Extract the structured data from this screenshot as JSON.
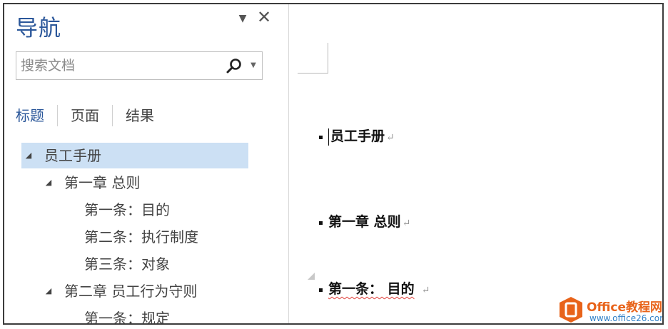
{
  "nav": {
    "title": "导航",
    "menu_glyph": "▼",
    "close_glyph": "✕",
    "search": {
      "placeholder": "搜索文档",
      "value": "",
      "dropdown_glyph": "▼"
    },
    "tabs": [
      {
        "label": "标题",
        "active": true
      },
      {
        "label": "页面",
        "active": false
      },
      {
        "label": "结果",
        "active": false
      }
    ],
    "tree": [
      {
        "label": "员工手册",
        "level": 1,
        "expanded": true,
        "selected": true,
        "arrow": "◢"
      },
      {
        "label": "第一章 总则",
        "level": 2,
        "expanded": true,
        "selected": false,
        "arrow": "◢"
      },
      {
        "label": "第一条：目的",
        "level": 3,
        "selected": false
      },
      {
        "label": "第二条：执行制度",
        "level": 3,
        "selected": false
      },
      {
        "label": "第三条：对象",
        "level": 3,
        "selected": false
      },
      {
        "label": "第二章 员工行为守则",
        "level": 2,
        "expanded": true,
        "selected": false,
        "arrow": "◢"
      },
      {
        "label": "第一条：规定",
        "level": 3,
        "selected": false
      }
    ]
  },
  "document": {
    "headings": [
      {
        "text": "员工手册",
        "level": 1
      },
      {
        "text": "第一章  总则",
        "level": 2
      },
      {
        "text": "第一条： 目的",
        "level": 3
      }
    ],
    "paragraph_mark": "↵"
  },
  "watermark": {
    "brand": "Office教程网",
    "url": "www.office26.com"
  },
  "colors": {
    "accent": "#2b579a",
    "selection": "#cce0f4",
    "watermark_orange": "#e8631a",
    "watermark_blue": "#2f80c8"
  }
}
